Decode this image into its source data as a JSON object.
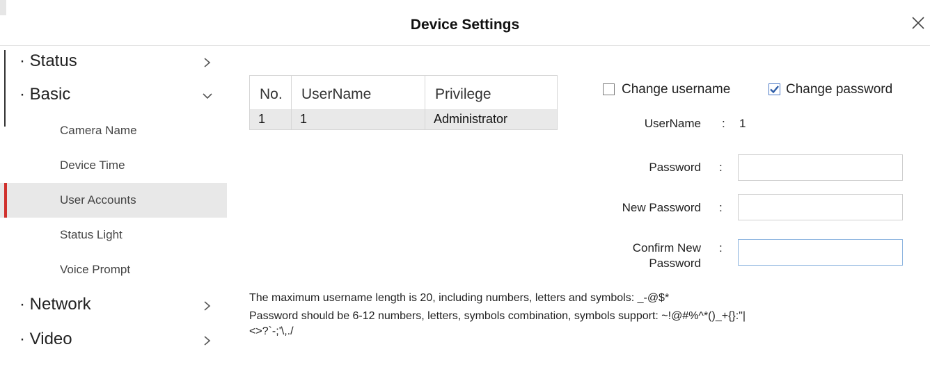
{
  "window": {
    "title": "Device Settings"
  },
  "sidebar": {
    "sections": [
      {
        "label": "· Status",
        "expanded": false
      },
      {
        "label": "· Basic",
        "expanded": true
      },
      {
        "label": "· Network",
        "expanded": false
      },
      {
        "label": "· Video",
        "expanded": false
      }
    ],
    "basic_items": [
      {
        "label": "Camera Name"
      },
      {
        "label": "Device Time"
      },
      {
        "label": "User Accounts",
        "active": true
      },
      {
        "label": "Status Light"
      },
      {
        "label": "Voice Prompt"
      }
    ]
  },
  "users_table": {
    "columns": [
      "No.",
      "UserName",
      "Privilege"
    ],
    "rows": [
      {
        "no": "1",
        "username": "1",
        "privilege": "Administrator"
      }
    ]
  },
  "form": {
    "change_username": {
      "label": "Change username",
      "checked": false
    },
    "change_password": {
      "label": "Change password",
      "checked": true
    },
    "username_label": "UserName",
    "username_value": "1",
    "password_label": "Password",
    "new_password_label": "New Password",
    "confirm_label_line1": "Confirm New",
    "confirm_label_line2": "Password",
    "colon": ":",
    "password_value": "",
    "new_password_value": "",
    "confirm_value": ""
  },
  "notes": {
    "username_rule": "The maximum username length is 20, including numbers, letters and symbols: _-@$*",
    "password_rule_line1": "Password should be 6-12 numbers, letters, symbols combination, symbols support: ~!@#%^*()_+{}:\"|",
    "password_rule_line2": "<>?`-;'\\,./"
  },
  "colors": {
    "accent_active": "#d0312d",
    "checkbox_check": "#2f5ea8"
  }
}
